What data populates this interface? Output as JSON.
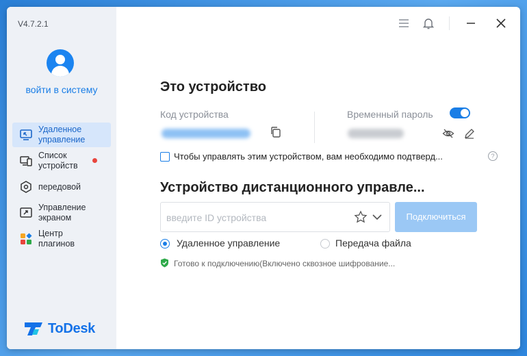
{
  "version": "V4.7.2.1",
  "login_text": "войти в систему",
  "nav": [
    {
      "label": "Удаленное управление",
      "icon": "monitor-remote-icon",
      "active": true
    },
    {
      "label": "Список устройств",
      "icon": "devices-list-icon",
      "badge": true
    },
    {
      "label": "передовой",
      "icon": "hexagon-settings-icon"
    },
    {
      "label": "Управление экраном",
      "icon": "screen-arrow-icon"
    },
    {
      "label": "Центр плагинов",
      "icon": "plugins-grid-icon"
    }
  ],
  "brand": "ToDesk",
  "this_device": {
    "title": "Это устройство",
    "code_label": "Код устройства",
    "temp_password_label": "Временный пароль",
    "permission_text": "Чтобы управлять этим устройством, вам необходимо подтверд..."
  },
  "remote": {
    "title": "Устройство дистанционного управле...",
    "id_placeholder": "введите ID устройства",
    "connect_label": "Подключиться",
    "mode_remote": "Удаленное управление",
    "mode_file": "Передача файла",
    "status": "Готово к подключению(Включено сквозное шифрование..."
  },
  "colors": {
    "accent": "#1a7ee6",
    "connect_disabled": "#9bc8f5",
    "badge": "#e8453c",
    "status_ok": "#2eaa4a"
  }
}
